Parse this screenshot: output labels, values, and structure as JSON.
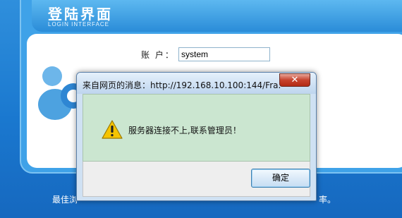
{
  "page": {
    "title_cn": "登陆界面",
    "title_en": "LOGIN INTERFACE",
    "account_label": "账  户：",
    "account_value": "system",
    "footer_left": "最佳浏",
    "footer_right": "率。"
  },
  "dialog": {
    "title": "来自网页的消息：http://192.168.10.100:144/Fra...",
    "message": "服务器连接不上,联系管理员！",
    "ok_label": "确定",
    "close_label": "✕",
    "icon": "warning-icon"
  },
  "colors": {
    "page_background": "#1a78cf",
    "dialog_content_background": "#cbe6d0",
    "close_button": "#c7432e",
    "warning_yellow": "#f5c400"
  }
}
